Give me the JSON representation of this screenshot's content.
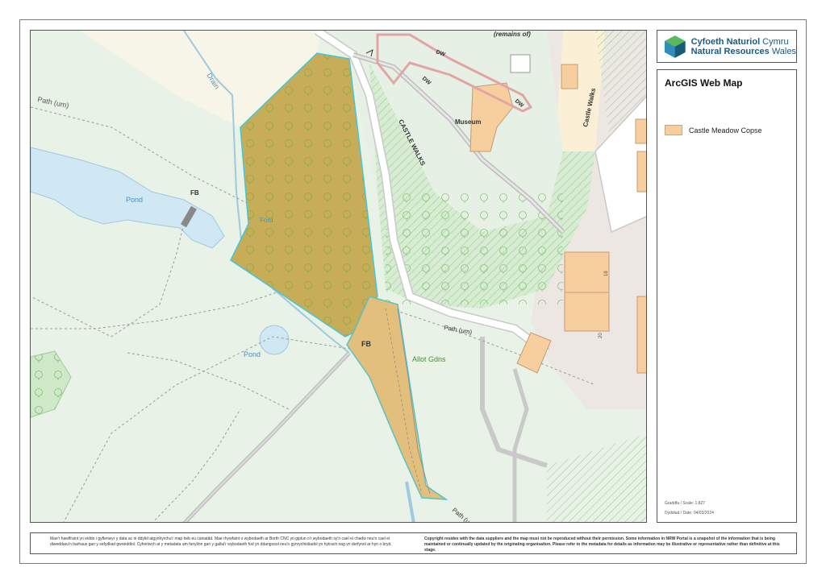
{
  "map": {
    "labels": {
      "drain": "Drain",
      "path_um_top": "Path (um)",
      "pond_large": "Pond",
      "fb_top": "FB",
      "ford": "Ford",
      "pond_small": "Pond",
      "fb_bottom": "FB",
      "allot_gdns": "Allot Gdns",
      "path_um_right": "Path (um)",
      "path_bottom": "Path (u",
      "remains_of": "(remains of)",
      "dw_1": "DW",
      "dw_2": "DW",
      "dw_3": "DW",
      "museum": "Museum",
      "castle_walks_diag": "CASTLE WALKS",
      "castle_walks_vert": "Castle Walks",
      "num_18": "18",
      "num_20": "20"
    },
    "colors": {
      "background": "#e9f2e6",
      "woodland_fill": "#c7ad58",
      "woodland_outline": "#44c6d8",
      "copse_fill": "#f2c98f",
      "water": "#cfe8f4",
      "water_edge": "#9ec9e0",
      "building": "#f7cf9e",
      "road": "#ffffff",
      "hatch": "#8fc98a"
    }
  },
  "logo": {
    "line1_bold": "Cyfoeth Naturiol",
    "line1_rest": " Cymru",
    "line2_bold": "Natural Resources",
    "line2_rest": " Wales"
  },
  "legend": {
    "title": "ArcGIS Web Map",
    "items": [
      {
        "label": "Castle Meadow Copse",
        "color": "#f7cf9e"
      }
    ],
    "scale": "Graddfa / Scale: 1:827",
    "date": "Dyddiad / Date: 04/03/2024"
  },
  "footer": {
    "left_text": "Mae'r hawlfraint yn eiddo i gyflenwyr y data ac ni ddylid atgynhyrchu'r map heb eu caniatâd. Mae rhywfaint o wybodaeth ar Borth CNC yn giplun o'r wybodaeth sy'n cael ei chadw neu'n cael ei diweddaru'n barhaus gan y sefydliad gwreiddiol. Cyfeiriwch at y metadata am fanylion gan y gallai'r wybodaeth fod yn ddangosol neu'n gynrychioliadol yn hytrach nag yn derfynol ar hyn o bryd.",
    "right_text": "Copyright resides with the data suppliers and the map must not be reproduced without their permission. Some information in NRW Portal is a snapshot of the information that is being maintained or continually updated by the originating organisation. Please refer to the metadata for details as information may be illustrative or representative rather than definitive at this stage."
  }
}
